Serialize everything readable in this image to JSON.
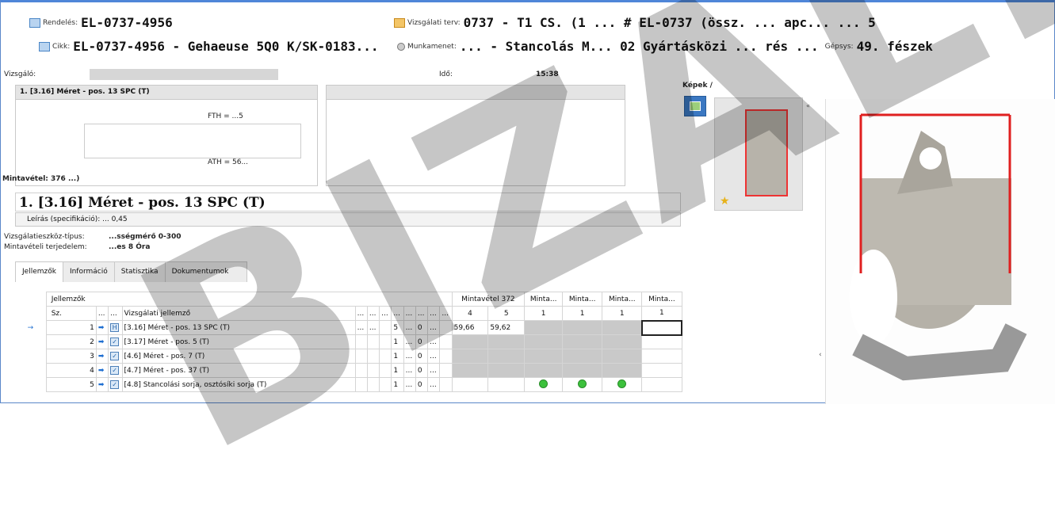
{
  "header": {
    "rendeles_label": "Rendelés:",
    "rendeles_value": "EL-0737-4956",
    "vizsgalati_label": "Vizsgálati terv:",
    "vizsgalati_value": "0737 - T1 CS. (1 ... # EL-0737 (össz. ... apc... ... 5",
    "cikk_label": "Cikk:",
    "cikk_value": "EL-0737-4956 - Gehaeuse 5Q0 K/SK-0183...",
    "munkamenet_label": "Munkamenet:",
    "munkamenet_value": "... - Stancolás M... 02 Gyártásközi ... rés ...",
    "gepsys_label": "Gépsys:",
    "gepsys_value": "49. fészek"
  },
  "info": {
    "vizsgalo_label": "Vizsgáló:",
    "ido_label": "Idő:",
    "ido_value": "15:38"
  },
  "panel_top": {
    "title": "1. [3.16] Méret - pos. 13 SPC (T)",
    "fth": "FTH = ...5",
    "ath": "ATH = 56...",
    "mintavetel": "Mintavétel: 376 ...)"
  },
  "main_title": "1. [3.16] Méret - pos. 13 SPC (T)",
  "leiras": "Leírás (specifikáció): ... 0,45",
  "eszkoz_label": "Vizsgálatieszköz-típus:",
  "eszkoz_value": "...sségmérő 0-300",
  "terjedelem_label": "Mintavételi terjedelem:",
  "terjedelem_value": "...es 8 Óra",
  "tabs": [
    "Jellemzők",
    "Információ",
    "Statisztika",
    "Dokumentumok"
  ],
  "kepek_label": "Képek /",
  "watermark": "BIZALMAS",
  "grid": {
    "section": "Jellemzők",
    "sz_header": "Sz.",
    "jellemzo_header": "Vizsgálati jellemző",
    "minta_headers": [
      "Mintavétel 372",
      "Minta...",
      "Minta...",
      "Minta...",
      "Minta..."
    ],
    "sub_headers": [
      "4",
      "5",
      "1",
      "1",
      "1",
      "1"
    ],
    "rows": [
      {
        "num": "1",
        "name": "[3.16] Méret - pos. 13 SPC (T)",
        "a": "5",
        "b": "0",
        "v1": "59,66",
        "v2": "59,62"
      },
      {
        "num": "2",
        "name": "[3.17] Méret - pos. 5 (T)",
        "a": "1",
        "b": "0",
        "v1": "",
        "v2": ""
      },
      {
        "num": "3",
        "name": "[4.6] Méret - pos. 7 (T)",
        "a": "1",
        "b": "0",
        "v1": "",
        "v2": ""
      },
      {
        "num": "4",
        "name": "[4.7] Méret - pos. 37 (T)",
        "a": "1",
        "b": "0",
        "v1": "",
        "v2": ""
      },
      {
        "num": "5",
        "name": "[4.8] Stancolási sorja, osztósíki sorja (T)",
        "a": "1",
        "b": "0",
        "v1": "",
        "v2": ""
      }
    ]
  }
}
